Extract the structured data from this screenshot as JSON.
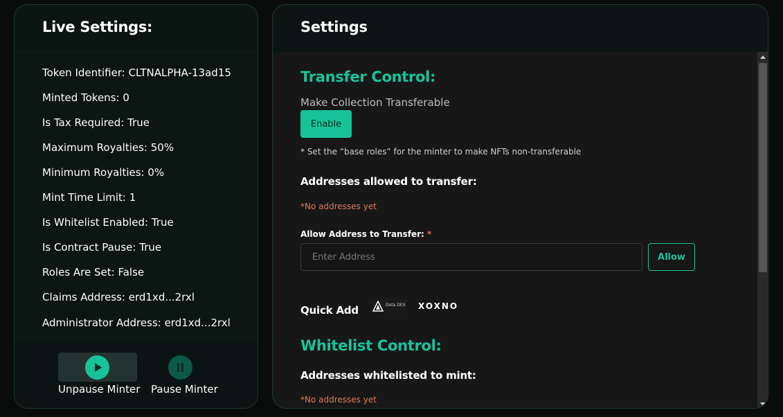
{
  "live_settings": {
    "title": "Live Settings:",
    "rows": [
      "Token Identifier: CLTNALPHA-13ad15",
      "Minted Tokens: 0",
      "Is Tax Required: True",
      "Maximum Royalties: 50%",
      "Minimum Royalties: 0%",
      "Mint Time Limit: 1",
      "Is Whitelist Enabled: True",
      "Is Contract Pause: True",
      "Roles Are Set: False",
      "Claims Address: erd1xd...2rxl",
      "Administrator Address: erd1xd...2rxl"
    ],
    "unpause_label": "Unpause Minter",
    "pause_label": "Pause Minter"
  },
  "settings": {
    "title": "Settings",
    "transfer_control": {
      "title": "Transfer Control:",
      "make_transferable_label": "Make Collection Transferable",
      "enable_button": "Enable",
      "note": "* Set the “base roles” for the minter to make NFTs non-transferable",
      "addresses_title": "Addresses allowed to transfer:",
      "empty_text": "*No addresses yet",
      "field_label": "Allow Address to Transfer:",
      "required_mark": "*",
      "input_placeholder": "Enter Address",
      "allow_button": "Allow",
      "quick_add_label": "Quick Add",
      "quick_add_logos": [
        "Data DEX",
        "XOXNO"
      ]
    },
    "whitelist_control": {
      "title": "Whitelist Control:",
      "addresses_title": "Addresses whitelisted to mint:",
      "empty_text": "*No addresses yet"
    }
  },
  "colors": {
    "accent": "#19c39a",
    "warning": "#e07a5f",
    "panel_border": "#1f3a30"
  },
  "icons": {
    "unpause": "play-icon",
    "pause": "pause-icon"
  }
}
